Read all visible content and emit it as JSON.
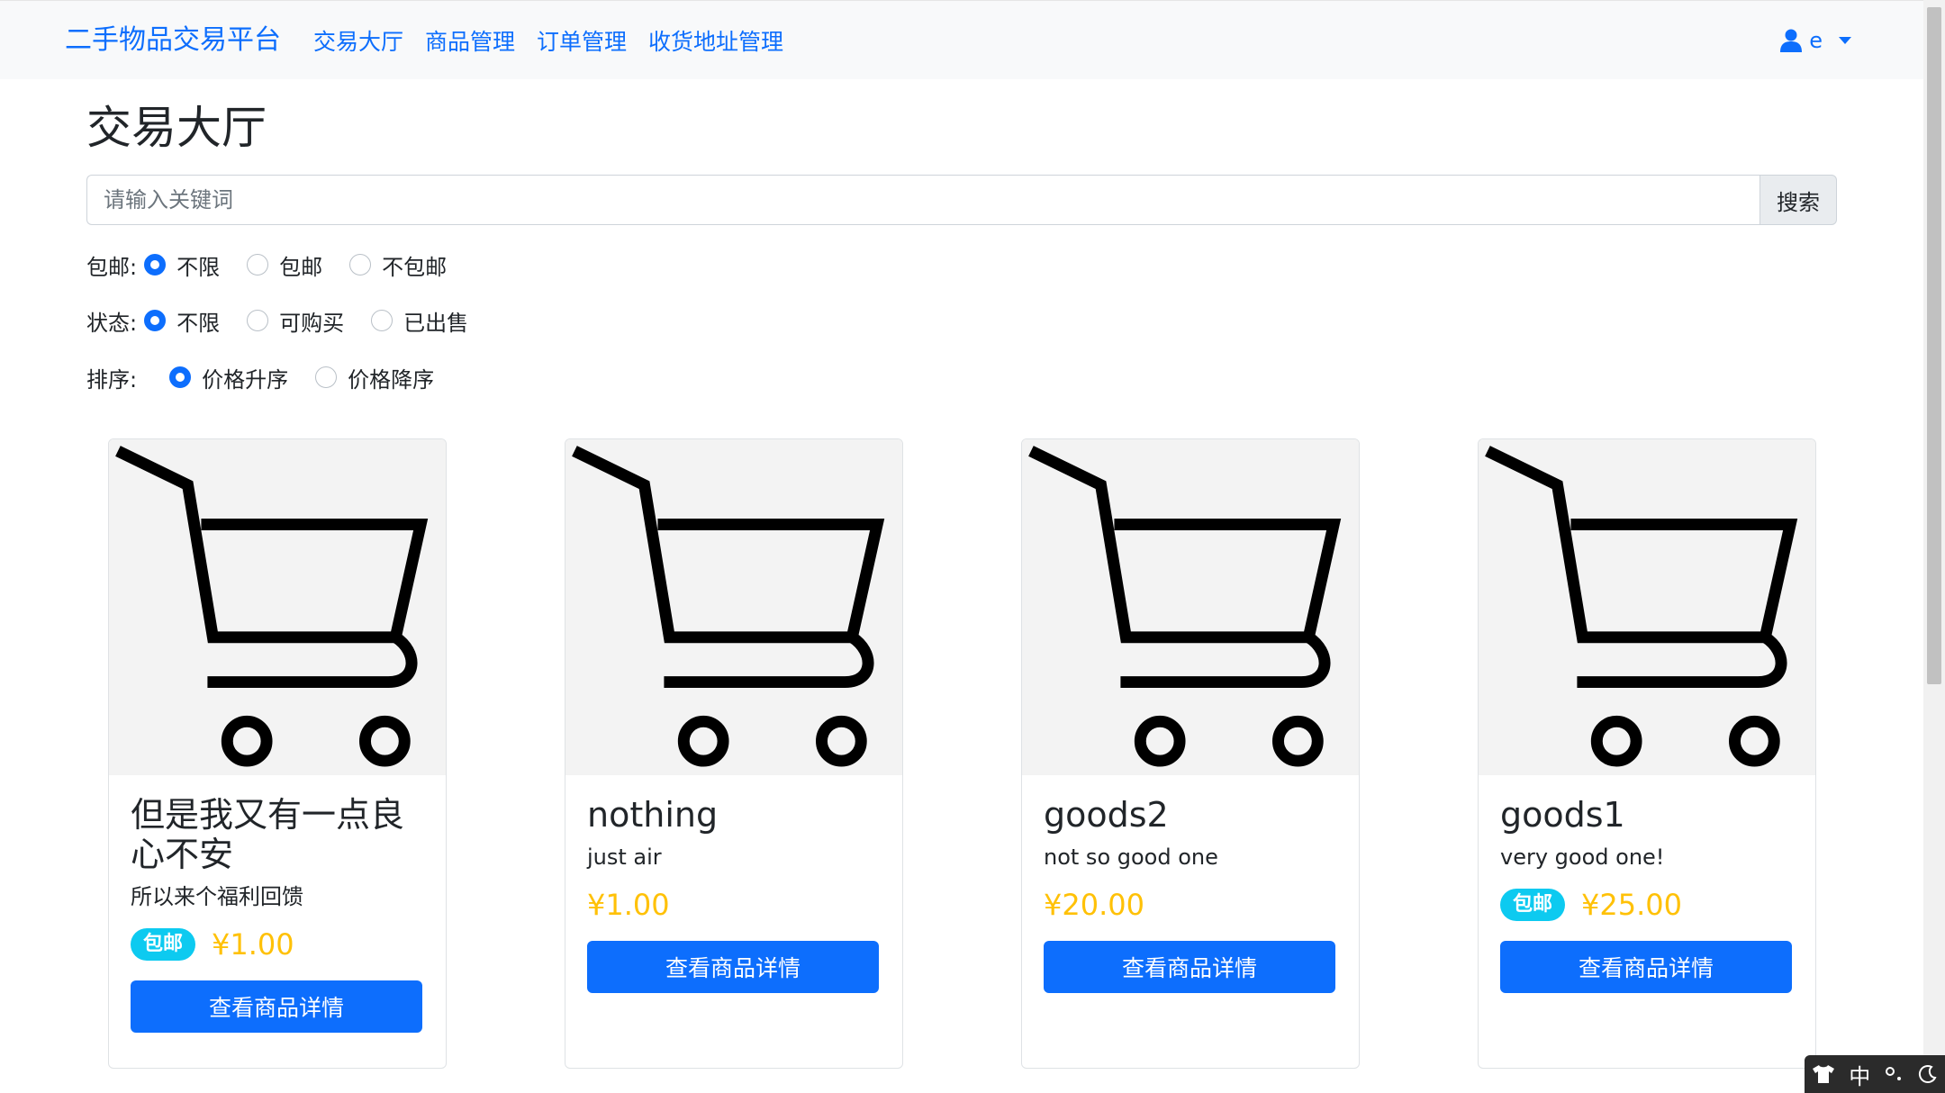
{
  "navbar": {
    "brand": "二手物品交易平台",
    "links": [
      "交易大厅",
      "商品管理",
      "订单管理",
      "收货地址管理"
    ],
    "user": "e"
  },
  "main": {
    "title": "交易大厅",
    "search": {
      "placeholder": "请输入关键词",
      "value": "",
      "button": "搜索"
    },
    "filters": [
      {
        "label": "包邮:",
        "options": [
          "不限",
          "包邮",
          "不包邮"
        ],
        "selected": "不限"
      },
      {
        "label": "状态:",
        "options": [
          "不限",
          "可购买",
          "已出售"
        ],
        "selected": "不限"
      },
      {
        "label": "排序:",
        "options": [
          "价格升序",
          "价格降序"
        ],
        "selected": "价格升序"
      }
    ]
  },
  "goods": [
    {
      "title": "但是我又有一点良心不安",
      "desc": "所以来个福利回馈",
      "badge": "包邮",
      "price": "¥1.00",
      "button": "查看商品详情"
    },
    {
      "title": "nothing",
      "desc": "just air",
      "badge": "",
      "price": "¥1.00",
      "button": "查看商品详情"
    },
    {
      "title": "goods2",
      "desc": "not so good one",
      "badge": "",
      "price": "¥20.00",
      "button": "查看商品详情"
    },
    {
      "title": "goods1",
      "desc": "very good one!",
      "badge": "包邮",
      "price": "¥25.00",
      "button": "查看商品详情"
    }
  ],
  "ime": {
    "label": "中"
  },
  "colors": {
    "primary": "#0d6efd",
    "price": "#ffc107",
    "badge": "#0dcaf0",
    "navbar_bg": "#f8f9fa"
  },
  "icons": {
    "user": "user-icon",
    "product": "shopping-cart-icon"
  }
}
